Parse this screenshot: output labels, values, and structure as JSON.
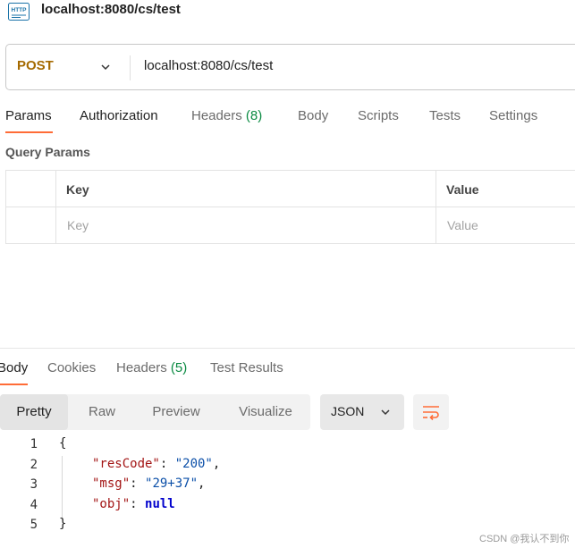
{
  "title": "localhost:8080/cs/test",
  "http_icon_text": "HTTP",
  "request": {
    "method": "POST",
    "method_color": "#a56a00",
    "url": "localhost:8080/cs/test"
  },
  "request_tabs": {
    "params": "Params",
    "authorization": "Authorization",
    "headers": "Headers",
    "headers_count": "(8)",
    "body": "Body",
    "scripts": "Scripts",
    "tests": "Tests",
    "settings": "Settings"
  },
  "query_params": {
    "title": "Query Params",
    "columns": [
      "Key",
      "Value"
    ],
    "placeholders": [
      "Key",
      "Value"
    ]
  },
  "response_tabs": {
    "body": "Body",
    "cookies": "Cookies",
    "headers": "Headers",
    "headers_count": "(5)",
    "test_results": "Test Results"
  },
  "view_modes": {
    "pretty": "Pretty",
    "raw": "Raw",
    "preview": "Preview",
    "visualize": "Visualize"
  },
  "format": "JSON",
  "code": {
    "line_numbers": [
      "1",
      "2",
      "3",
      "4",
      "5"
    ],
    "open_brace": "{",
    "close_brace": "}",
    "k1": "\"resCode\"",
    "v1": "\"200\"",
    "k2": "\"msg\"",
    "v2": "\"29+37\"",
    "k3": "\"obj\"",
    "v3": "null",
    "colon": ": ",
    "comma": ","
  },
  "watermark": "CSDN @我认不到你",
  "colors": {
    "accent": "#ff6c37",
    "count_green": "#0a8a42",
    "json_key": "#a31515",
    "json_string": "#0b4fa8"
  },
  "icons": [
    "http-icon",
    "chevron-down-icon",
    "wrap-lines-icon"
  ]
}
